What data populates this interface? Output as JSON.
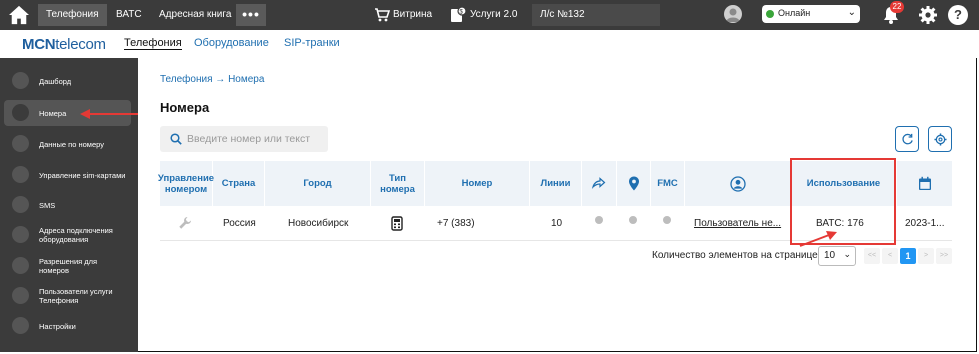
{
  "topbar": {
    "tabs": [
      {
        "label": "Телефония",
        "active": true
      },
      {
        "label": "ВАТС",
        "active": false
      },
      {
        "label": "Адресная книга",
        "active": false
      }
    ],
    "more_label": "•••",
    "showcase_label": "Витрина",
    "services_label": "Услуги 2.0",
    "account_label": "Л/с №132",
    "status_label": "Онлайн",
    "notifications_count": "22"
  },
  "subnav": {
    "logo_bold": "MCN",
    "logo_rest": "telecom",
    "tabs": [
      {
        "label": "Телефония",
        "active": true
      },
      {
        "label": "Оборудование",
        "active": false
      },
      {
        "label": "SIP-транки",
        "active": false
      }
    ]
  },
  "sidebar": {
    "items": [
      {
        "label": "Дашборд",
        "icon": "dashboard-icon"
      },
      {
        "label": "Номера",
        "icon": "phone-icon",
        "active": true
      },
      {
        "label": "Данные по номеру",
        "icon": "data-icon"
      },
      {
        "label": "Управление sim-картами",
        "icon": "sim-icon"
      },
      {
        "label": "SMS",
        "icon": "sms-icon"
      },
      {
        "label": "Адреса подключения оборудования",
        "icon": "address-icon"
      },
      {
        "label": "Разрешения для номеров",
        "icon": "permission-icon"
      },
      {
        "label": "Пользователи услуги Телефония",
        "icon": "users-icon"
      },
      {
        "label": "Настройки",
        "icon": "settings-icon"
      }
    ]
  },
  "breadcrumb": {
    "root": "Телефония",
    "arrow": "→",
    "current": "Номера"
  },
  "page_title": "Номера",
  "search": {
    "placeholder": "Введите номер или текст"
  },
  "table": {
    "headers": {
      "manage": "Управление номером",
      "country": "Страна",
      "city": "Город",
      "number_type": "Тип номера",
      "number": "Номер",
      "lines": "Линии",
      "fmc": "FMC",
      "usage": "Использование"
    },
    "rows": [
      {
        "country": "Россия",
        "city": "Новосибирск",
        "number": "+7 (383)",
        "lines": "10",
        "user": "Пользователь не...",
        "usage": "ВАТС: 176",
        "date": "2023-1..."
      }
    ]
  },
  "pagination": {
    "label": "Количество элементов на странице",
    "page_size": "10",
    "first": "<<",
    "prev": "<",
    "current_page": "1",
    "next": ">",
    "last": ">>"
  },
  "colors": {
    "accent": "#1f6fb0",
    "annotation": "#e53935",
    "sidebar": "#3b3b3b"
  }
}
